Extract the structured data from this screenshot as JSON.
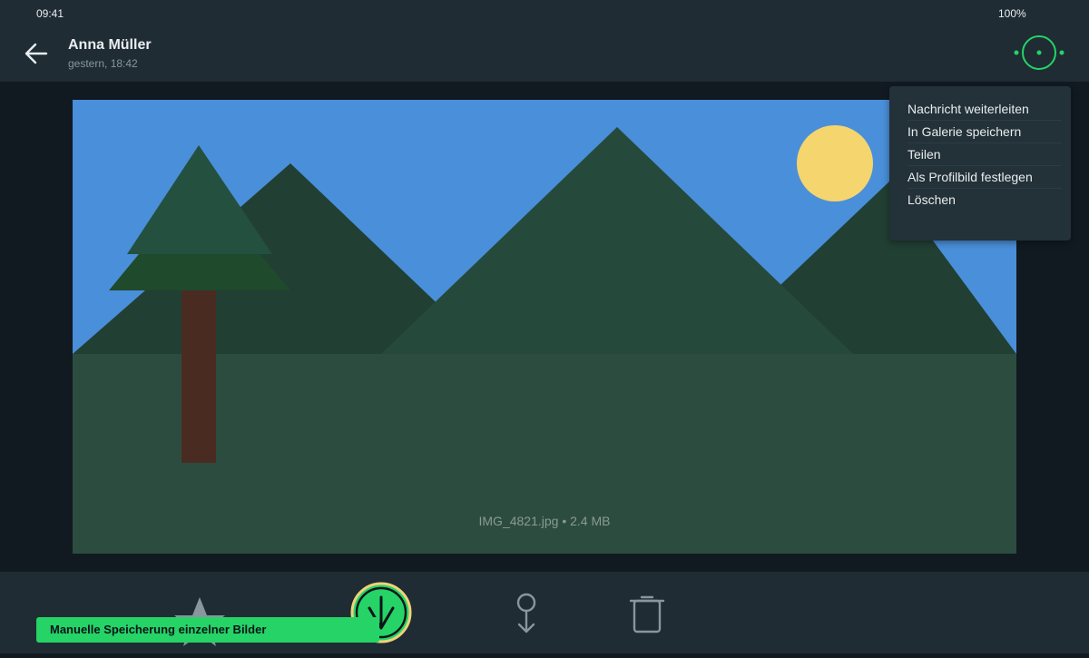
{
  "status": {
    "time": "09:41",
    "battery": "100%"
  },
  "header": {
    "back_icon": "arrow-left-icon",
    "contact_name": "Anna Müller",
    "timestamp": "gestern, 18:42",
    "menu_icon": "more-options-icon"
  },
  "media": {
    "filename_info": "IMG_4821.jpg • 2.4 MB"
  },
  "menu": {
    "items": [
      {
        "label": "Nachricht weiterleiten"
      },
      {
        "label": "In Galerie speichern"
      },
      {
        "label": "Teilen"
      },
      {
        "label": "Als Profilbild festlegen"
      },
      {
        "label": "Löschen"
      }
    ]
  },
  "bottom_bar": {
    "icons": [
      "star-icon",
      "save-icon",
      "pin-icon",
      "delete-icon"
    ]
  },
  "toast": {
    "text": "Manuelle Speicherung einzelner Bilder"
  },
  "colors": {
    "accent": "#25d366",
    "highlight_ring": "#f0d27a",
    "background": "#111a21",
    "bar": "#1f2c34",
    "menu_bg": "#233138"
  }
}
